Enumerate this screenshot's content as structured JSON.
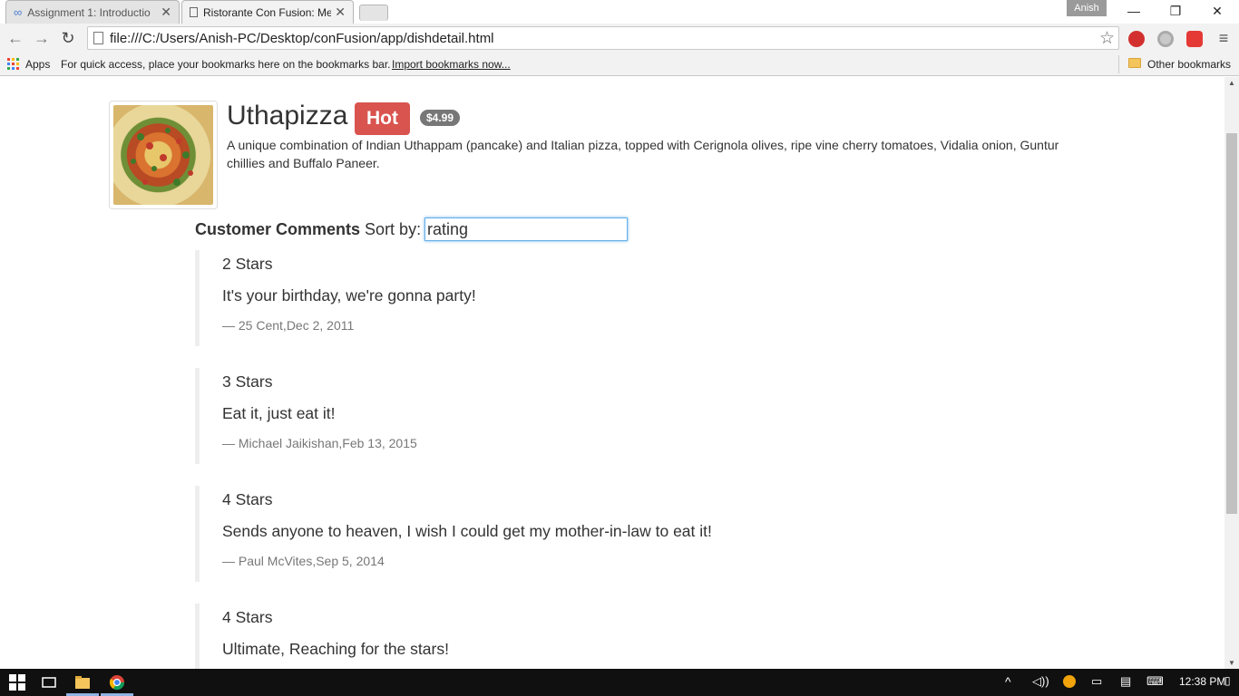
{
  "browser": {
    "tabs": [
      {
        "title": "Assignment 1: Introductio",
        "active": false
      },
      {
        "title": "Ristorante Con Fusion: Me",
        "active": true
      }
    ],
    "profile": "Anish",
    "url": "file:///C:/Users/Anish-PC/Desktop/conFusion/app/dishdetail.html",
    "bookmarks": {
      "apps_label": "Apps",
      "hint": "For quick access, place your bookmarks here on the bookmarks bar.",
      "import_link": "Import bookmarks now...",
      "other_label": "Other bookmarks"
    }
  },
  "dish": {
    "name": "Uthapizza",
    "label": "Hot",
    "price": "$4.99",
    "description": "A unique combination of Indian Uthappam (pancake) and Italian pizza, topped with Cerignola olives, ripe vine cherry tomatoes, Vidalia onion, Guntur chillies and Buffalo Paneer."
  },
  "comments_section": {
    "heading": "Customer Comments",
    "sort_label": "Sort by:",
    "sort_value": "rating",
    "comments": [
      {
        "stars": "2 Stars",
        "text": "It's your birthday, we're gonna party!",
        "byline": "— 25 Cent,Dec 2, 2011"
      },
      {
        "stars": "3 Stars",
        "text": "Eat it, just eat it!",
        "byline": "— Michael Jaikishan,Feb 13, 2015"
      },
      {
        "stars": "4 Stars",
        "text": "Sends anyone to heaven, I wish I could get my mother-in-law to eat it!",
        "byline": "— Paul McVites,Sep 5, 2014"
      },
      {
        "stars": "4 Stars",
        "text": "Ultimate, Reaching for the stars!",
        "byline": ""
      }
    ]
  },
  "taskbar": {
    "time": "12:38 PM"
  },
  "colors": {
    "hot_label": "#d9534f",
    "price_badge": "#777777",
    "input_focus": "#66afe9"
  }
}
